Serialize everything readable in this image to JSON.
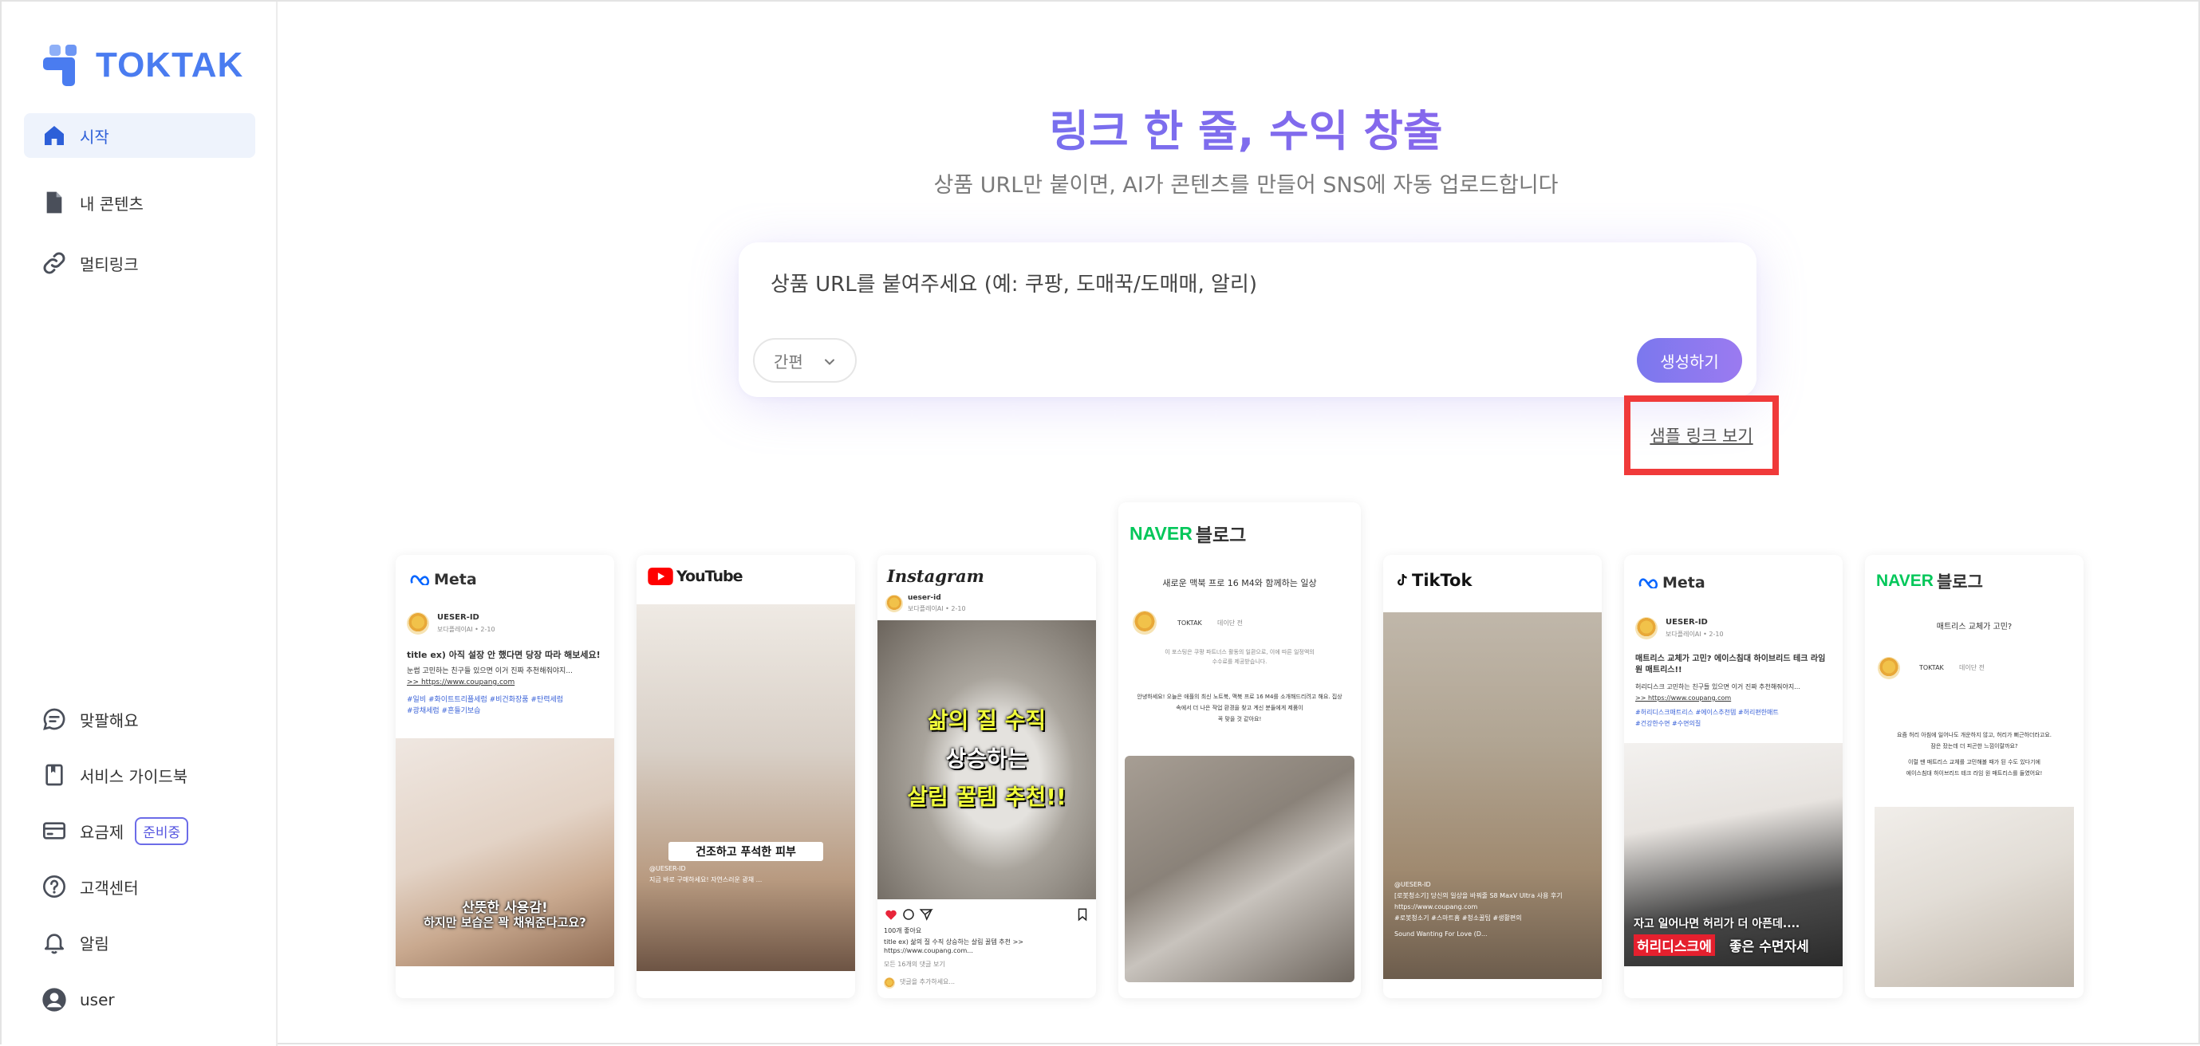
{
  "app": {
    "brand": "TOKTAK",
    "accent": "#4a7cf0"
  },
  "sidebar": {
    "items_top": [
      {
        "label": "시작",
        "icon": "home-icon",
        "active": true
      },
      {
        "label": "내 콘텐츠",
        "icon": "document-icon"
      },
      {
        "label": "멀티링크",
        "icon": "link-icon"
      }
    ],
    "items_bottom": [
      {
        "label": "맞팔해요",
        "icon": "chat-icon"
      },
      {
        "label": "서비스 가이드북",
        "icon": "book-icon"
      },
      {
        "label": "요금제",
        "icon": "card-icon",
        "badge": "준비중"
      },
      {
        "label": "고객센터",
        "icon": "help-icon"
      },
      {
        "label": "알림",
        "icon": "bell-icon"
      },
      {
        "label": "user",
        "icon": "user-icon"
      }
    ]
  },
  "hero": {
    "title": "링크 한 줄, 수익 창출",
    "subtitle": "상품 URL만 붙이면, AI가 콘텐츠를 만들어 SNS에 자동 업로드합니다"
  },
  "form": {
    "placeholder": "상품 URL를 붙여주세요 (예: 쿠팡, 도매꾹/도매매, 알리)",
    "mode": "간편",
    "generate": "생성하기",
    "sample_link": "샘플 링크 보기"
  },
  "cards": {
    "meta1": {
      "brand": "Meta",
      "user": "UESER-ID",
      "meta": "보다플레이AI • 2-10",
      "title": "title ex) 아직 설장 안 했다면 당장 따라 해보세요!",
      "body": "눈썹 고민하는 친구들 있으면 이거 진짜 추천해줘야지...",
      "link": ">> https://www.coupang.com",
      "tags1": "#일비 #화이트트리플세럼 #비건화장품 #탄력세럼",
      "tags2": "#광채세럼 #흔들기보습",
      "overlay1": "산뜻한 사용감!",
      "overlay2": "하지만 보습은 꽉 채워준다고요?"
    },
    "youtube": {
      "brand": "YouTube",
      "overlay": "건조하고 푸석한 피부",
      "user": "@UESER-ID",
      "caption": "지금 바로 구매하세요! 자연스러운 광채 ..."
    },
    "instagram": {
      "brand": "Instagram",
      "user": "ueser-id",
      "meta": "보다플레이AI • 2-10",
      "overlay1": "삶의 질 수직",
      "overlay2": "상승하는",
      "overlay3": "살림 꿀템 추천!!",
      "likes": "100개 좋아요",
      "caption": "title ex) 삶의 질 수직 상승하는 살림 꿀템 추천 >> https://www.coupang.com...",
      "comments": "모든 16개의 댓글 보기",
      "add_comment": "댓글을 추가하세요..."
    },
    "naver1": {
      "brand_logo": "NAVER",
      "brand_text": "블로그",
      "title": "새로운 맥북 프로 16 M4와 함께하는 일상",
      "author": "TOKTAK",
      "author_meta": "데이단 전",
      "p1": "이 포스팅은 쿠팡 파트너스 활동의 일환으로, 이에 따른 일정액의",
      "p2": "수수료를 제공받습니다.",
      "p3": "안녕하세요! 오늘은 애플의 최신 노트북, 맥북 프로 16 M4를 소개해드리려고 해요. 집상",
      "p4": "속에서 더 나은 작업 환경을 찾고 계신 분들에게 제품이",
      "p5": "꼭 맞을 것 같아요!"
    },
    "tiktok": {
      "brand": "TikTok",
      "user": "@UESER-ID",
      "caption": "[로봇청소기] 당신의 일상을 바꿔줄 S8 MaxV Ultra 사용 후기",
      "link": "https://www.coupang.com",
      "tags": "#로봇청소기 #스마트홈 #청소꿀팁 #생활편의",
      "music": "Sound Wanting For Love (D..."
    },
    "meta2": {
      "brand": "Meta",
      "user": "UESER-ID",
      "meta": "보다플레이AI • 2-10",
      "title": "매트리스 교체가 고민? 에이스침대 하이브리드 테크 라임 원 매트리스!!",
      "body": "허리디스크 고민하는 친구들 있으면 이거 진짜 추천해줘야지...",
      "link": ">> https://www.coupang.com",
      "tags1": "#허리디스크매트리스 #에이스추천템 #허리편한매트",
      "tags2": "#건강한수면 #수면의질",
      "overlay1": "자고 일어나면 허리가 더 아픈데....",
      "overlay2a": "허리디스크에",
      "overlay2b": "좋은 수면자세"
    },
    "naver2": {
      "brand_logo": "NAVER",
      "brand_text": "블로그",
      "title": "매트리스 교체가 고민?",
      "author": "TOKTAK",
      "author_meta": "데이단 전",
      "p1": "요즘 허리 아침에 일어나도 개운하지 않고, 허리가 뻐근하더라고요.",
      "p2": "잠은 잤는데 더 피곤한 느낌이랄까요?",
      "p3": "이럴 땐 매트리스 교체를 고민해볼 때가 된 수도 있다기에",
      "p4": "에이스침대 하이브리드 테크 라임 원 매트리스를 들였어요!"
    }
  }
}
